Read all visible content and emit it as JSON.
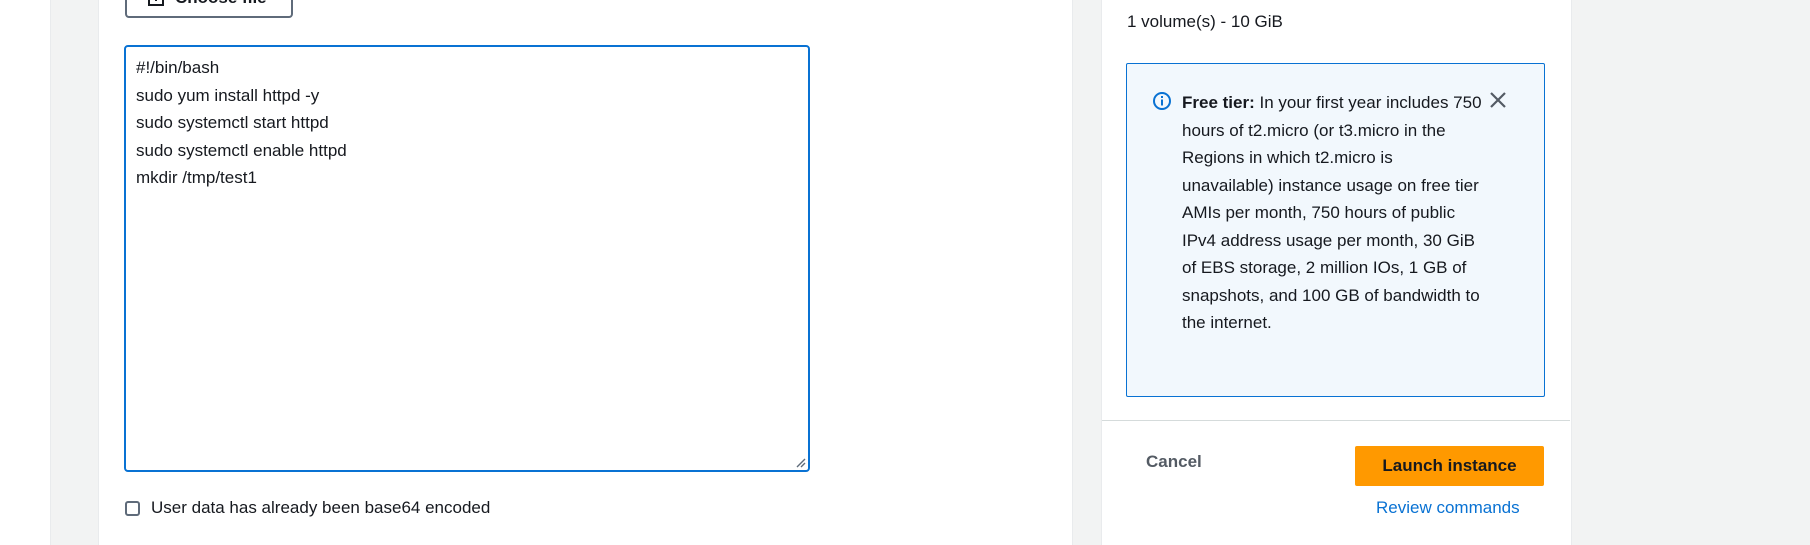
{
  "file_button": {
    "label": "Choose file",
    "icon": "upload-icon"
  },
  "user_data": {
    "lines": [
      "#!/bin/bash",
      "sudo yum install httpd -y",
      "sudo systemctl start httpd",
      "sudo systemctl enable httpd",
      "mkdir /tmp/test1"
    ]
  },
  "base64_checkbox": {
    "label": "User data has already been base64 encoded",
    "checked": false
  },
  "summary": {
    "volume_text": "1 volume(s) - 10 GiB"
  },
  "free_tier": {
    "title": "Free tier:",
    "message": "In your first year includes 750 hours of t2.micro (or t3.micro in the Regions in which t2.micro is unavailable) instance usage on free tier AMIs per month, 750 hours of public IPv4 address usage per month, 30 GiB of EBS storage, 2 million IOs, 1 GB of snapshots, and 100 GB of bandwidth to the internet.",
    "info_icon": "info-icon",
    "close_icon": "close-icon"
  },
  "actions": {
    "cancel_label": "Cancel",
    "launch_label": "Launch instance",
    "review_label": "Review commands"
  },
  "colors": {
    "accent": "#0972d3",
    "launch_button": "#ff9900",
    "info_background": "#f2f8fd"
  }
}
